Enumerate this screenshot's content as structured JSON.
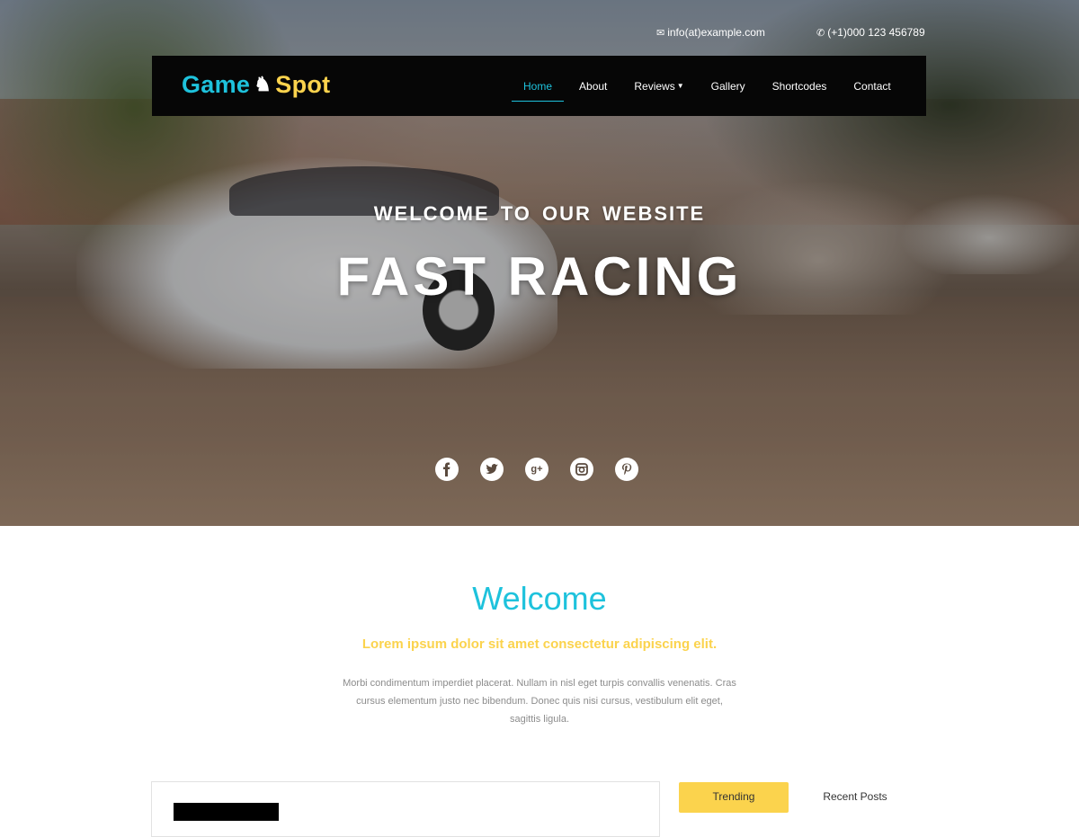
{
  "topbar": {
    "email_icon": "envelope-icon",
    "email": "info(at)example.com",
    "phone_icon": "phone-icon",
    "phone": "(+1)000 123 456789"
  },
  "logo": {
    "word1": "Game",
    "icon": "chess-knight-icon",
    "word2": "Spot",
    "colors": {
      "word1": "#1ec2dc",
      "word2": "#fbd34d"
    }
  },
  "nav": {
    "items": [
      {
        "label": "Home",
        "active": true
      },
      {
        "label": "About"
      },
      {
        "label": "Reviews",
        "dropdown": true
      },
      {
        "label": "Gallery"
      },
      {
        "label": "Shortcodes"
      },
      {
        "label": "Contact"
      }
    ]
  },
  "hero": {
    "subtitle": "WELCOME  TO  OUR  WEBSITE",
    "title": "FAST RACING",
    "social": [
      {
        "icon": "facebook-icon",
        "glyph": "f"
      },
      {
        "icon": "twitter-icon",
        "glyph": ""
      },
      {
        "icon": "google-plus-icon",
        "glyph": "g+"
      },
      {
        "icon": "instagram-icon",
        "glyph": ""
      },
      {
        "icon": "pinterest-icon",
        "glyph": "p"
      }
    ]
  },
  "welcome": {
    "title": "Welcome",
    "subtitle": "Lorem ipsum dolor sit amet consectetur adipiscing elit.",
    "body": "Morbi condimentum imperdiet placerat. Nullam in nisl eget turpis convallis venenatis. Cras cursus elementum justo nec bibendum. Donec quis nisi cursus, vestibulum elit eget, sagittis ligula."
  },
  "sidebar_tabs": {
    "trending": "Trending",
    "recent": "Recent Posts"
  },
  "colors": {
    "accent_cyan": "#1ec2dc",
    "accent_yellow": "#fbd34d",
    "navbar_bg": "#060606"
  }
}
